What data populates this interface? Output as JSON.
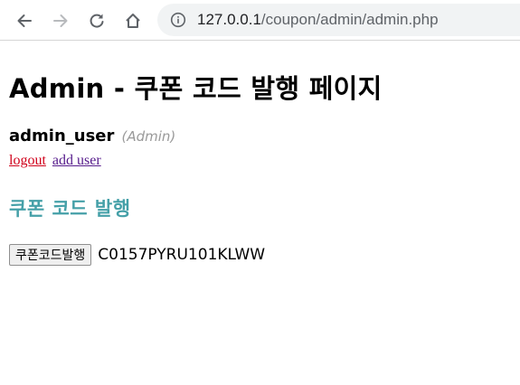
{
  "browser": {
    "url_host": "127.0.0.1",
    "url_path": "/coupon/admin/admin.php",
    "icons": {
      "back": "back-arrow-icon",
      "forward": "forward-arrow-icon",
      "reload": "reload-icon",
      "home": "home-icon",
      "info": "info-icon"
    }
  },
  "page": {
    "title": "Admin - 쿠폰 코드 발행 페이지",
    "user": {
      "username": "admin_user",
      "role": "(Admin)"
    },
    "links": {
      "logout": "logout",
      "add_user": "add user"
    },
    "section_heading": "쿠폰 코드 발행",
    "issue_button_label": "쿠폰코드발행",
    "coupon_code": "C0157PYRU101KLWW"
  },
  "colors": {
    "heading_accent": "#45a0a8",
    "logout_link": "#d0021b",
    "visited_link": "#551a8b",
    "role_text": "#9a9a9a"
  }
}
